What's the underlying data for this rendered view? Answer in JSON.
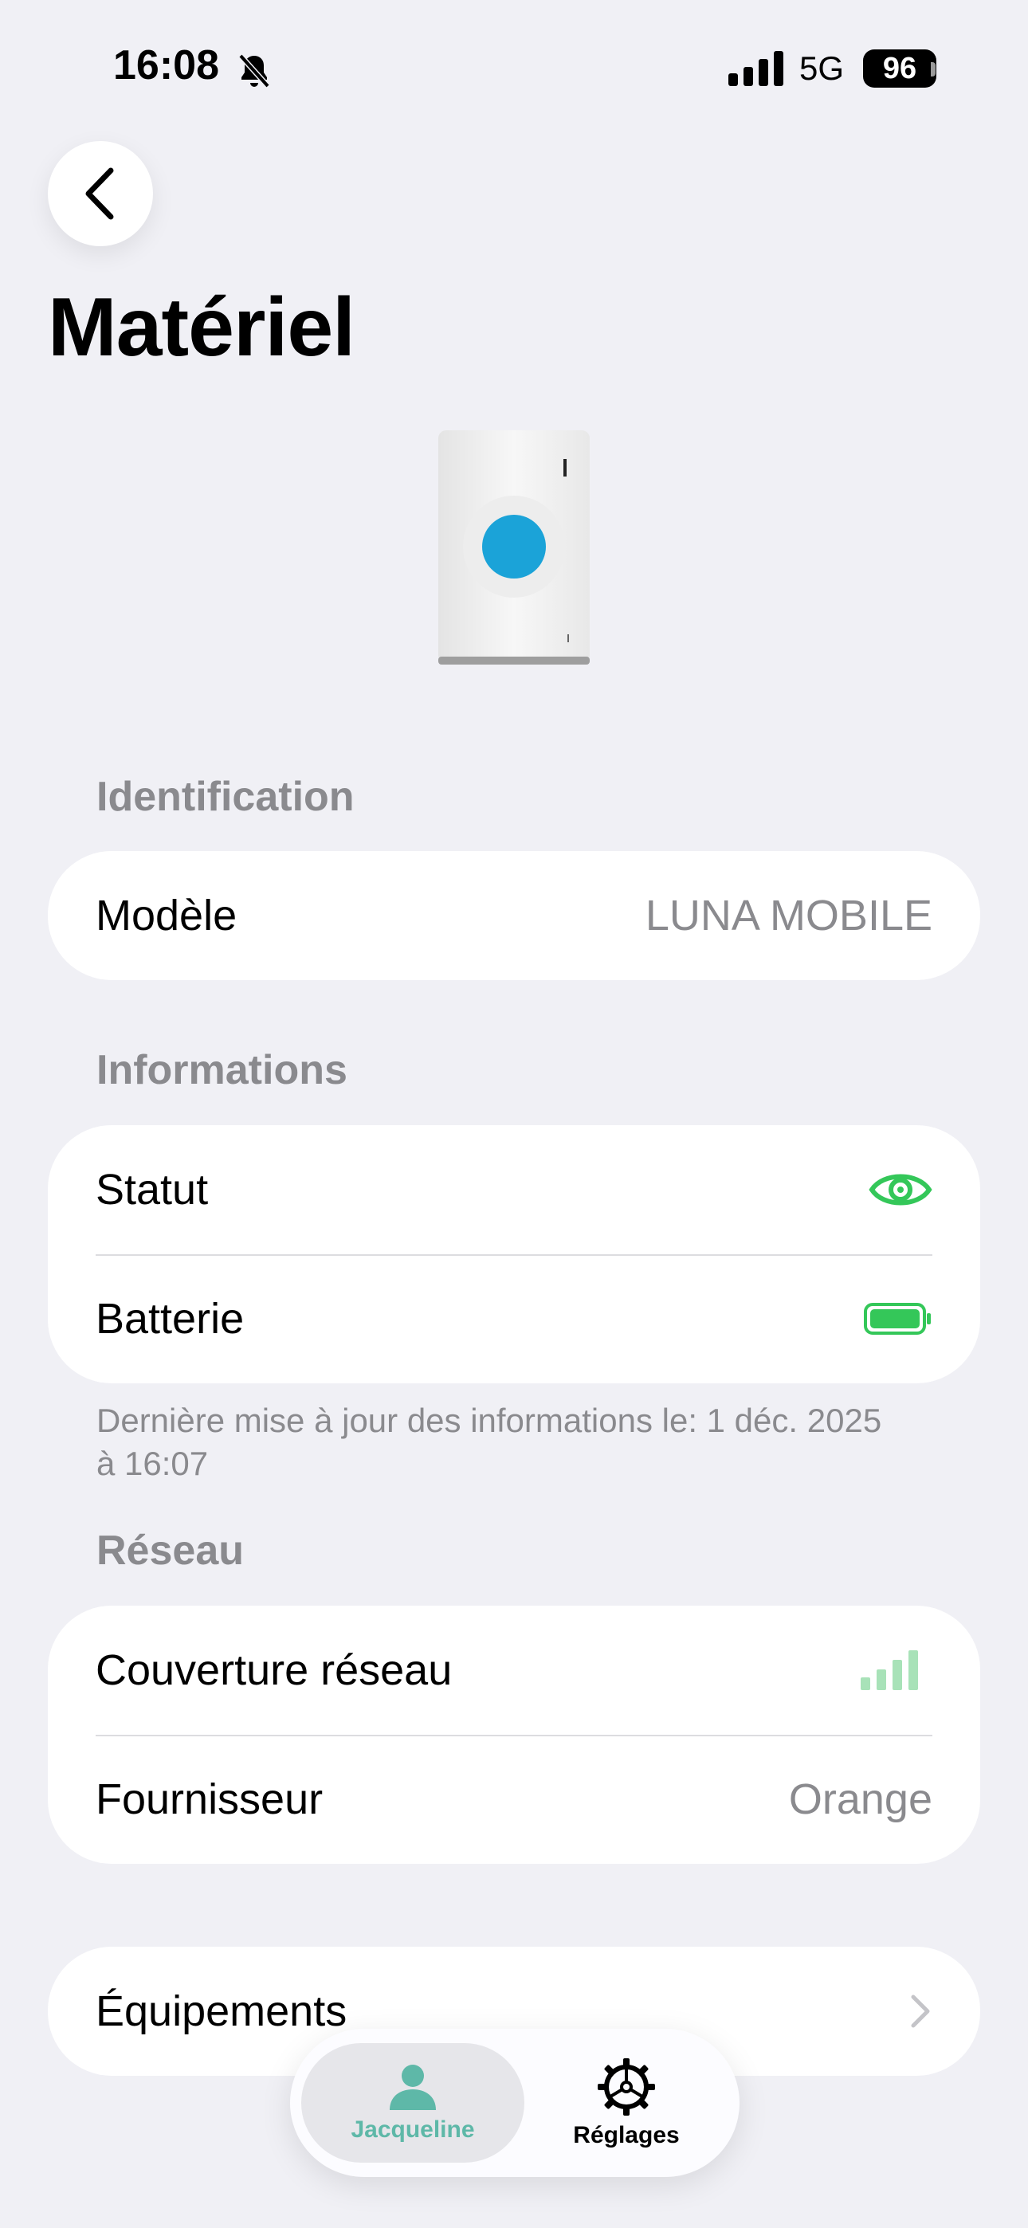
{
  "status_bar": {
    "time": "16:08",
    "network": "5G",
    "battery": "96"
  },
  "page": {
    "title": "Matériel"
  },
  "identification": {
    "header": "Identification",
    "rows": [
      {
        "label": "Modèle",
        "value": "LUNA MOBILE"
      }
    ]
  },
  "informations": {
    "header": "Informations",
    "rows": [
      {
        "label": "Statut",
        "icon": "eye-icon"
      },
      {
        "label": "Batterie",
        "icon": "battery-full-icon"
      }
    ],
    "footnote": "Dernière mise à jour des informations le: 1 déc. 2025 à 16:07"
  },
  "reseau": {
    "header": "Réseau",
    "rows": [
      {
        "label": "Couverture réseau",
        "icon": "signal-bars-icon"
      },
      {
        "label": "Fournisseur",
        "value": "Orange"
      }
    ]
  },
  "equipements": {
    "label": "Équipements"
  },
  "tabbar": {
    "tabs": [
      {
        "label": "Jacqueline",
        "icon": "person-icon",
        "active": true
      },
      {
        "label": "Réglages",
        "icon": "gear-icon",
        "active": false
      }
    ]
  },
  "colors": {
    "accent": "#5EB8A8",
    "green": "#34C759",
    "device_button": "#1BA3D8"
  }
}
